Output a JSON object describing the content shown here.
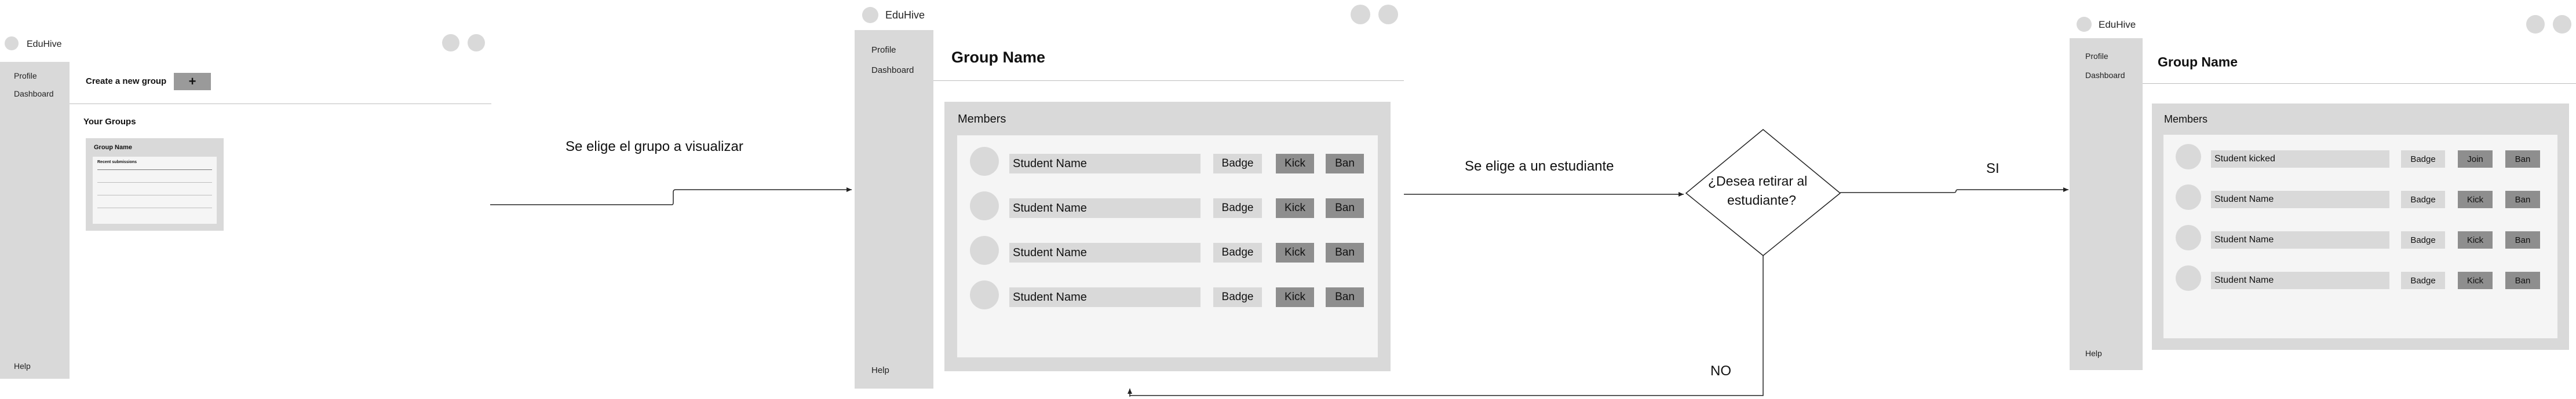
{
  "app": {
    "name": "EduHive"
  },
  "nav": {
    "profile": "Profile",
    "dashboard": "Dashboard",
    "help": "Help"
  },
  "screen1": {
    "create_label": "Create a new group",
    "create_button": "+",
    "your_groups": "Your Groups",
    "card_title": "Group Name",
    "card_subtitle": "Recent submissions"
  },
  "screen2": {
    "group_title": "Group Name",
    "members_label": "Members",
    "rows": [
      {
        "name": "Student Name",
        "badge": "Badge",
        "kick": "Kick",
        "ban": "Ban"
      },
      {
        "name": "Student Name",
        "badge": "Badge",
        "kick": "Kick",
        "ban": "Ban"
      },
      {
        "name": "Student Name",
        "badge": "Badge",
        "kick": "Kick",
        "ban": "Ban"
      },
      {
        "name": "Student Name",
        "badge": "Badge",
        "kick": "Kick",
        "ban": "Ban"
      }
    ]
  },
  "screen3": {
    "group_title": "Group Name",
    "members_label": "Members",
    "rows": [
      {
        "name": "Student kicked",
        "badge": "Badge",
        "kick": "Join",
        "ban": "Ban"
      },
      {
        "name": "Student Name",
        "badge": "Badge",
        "kick": "Kick",
        "ban": "Ban"
      },
      {
        "name": "Student Name",
        "badge": "Badge",
        "kick": "Kick",
        "ban": "Ban"
      },
      {
        "name": "Student Name",
        "badge": "Badge",
        "kick": "Kick",
        "ban": "Ban"
      }
    ]
  },
  "flow": {
    "label_choose_group": "Se elige el grupo a visualizar",
    "label_choose_student": "Se elige a un estudiante",
    "decision_line1": "¿Desea retirar al",
    "decision_line2": "estudiante?",
    "label_yes": "SI",
    "label_no": "NO"
  }
}
